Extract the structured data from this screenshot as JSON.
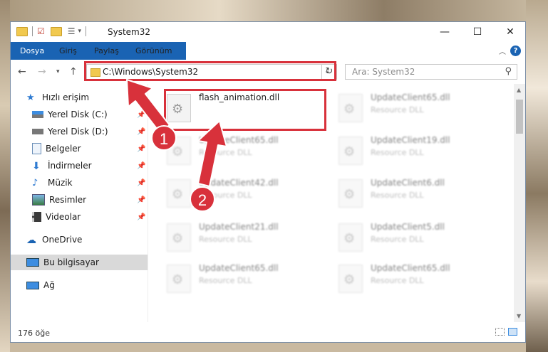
{
  "window": {
    "title": "System32",
    "minimize": "—",
    "maximize": "☐",
    "close": "✕"
  },
  "ribbon": {
    "tabs": [
      "Dosya",
      "Giriş",
      "Paylaş",
      "Görünüm"
    ],
    "help": "?"
  },
  "address": {
    "path": "C:\\Windows\\System32",
    "refresh": "↻"
  },
  "search": {
    "placeholder": "Ara: System32"
  },
  "sidebar": {
    "items": [
      {
        "label": "Hızlı erişim",
        "icon": "star-icon"
      },
      {
        "label": "Yerel Disk (C:)",
        "icon": "drive-icon"
      },
      {
        "label": "Yerel Disk (D:)",
        "icon": "drive-icon"
      },
      {
        "label": "Belgeler",
        "icon": "documents-icon"
      },
      {
        "label": "İndirmeler",
        "icon": "download-icon"
      },
      {
        "label": "Müzik",
        "icon": "music-icon"
      },
      {
        "label": "Resimler",
        "icon": "pictures-icon"
      },
      {
        "label": "Videolar",
        "icon": "videos-icon"
      },
      {
        "label": "OneDrive",
        "icon": "cloud-icon"
      },
      {
        "label": "Bu bilgisayar",
        "icon": "computer-icon"
      },
      {
        "label": "Ağ",
        "icon": "network-icon"
      }
    ]
  },
  "files": [
    {
      "name": "flash_animation.dll",
      "type": ""
    },
    {
      "name": "UpdateClient65.dll",
      "type": "Resource DLL"
    },
    {
      "name": "UpdateClient65.dll",
      "type": "Resource DLL"
    },
    {
      "name": "UpdateClient19.dll",
      "type": "Resource DLL"
    },
    {
      "name": "UpdateClient42.dll",
      "type": "Resource DLL"
    },
    {
      "name": "UpdateClient6.dll",
      "type": "Resource DLL"
    },
    {
      "name": "UpdateClient21.dll",
      "type": "Resource DLL"
    },
    {
      "name": "UpdateClient5.dll",
      "type": "Resource DLL"
    },
    {
      "name": "UpdateClient65.dll",
      "type": "Resource DLL"
    },
    {
      "name": "UpdateClient65.dll",
      "type": "Resource DLL"
    }
  ],
  "status": {
    "count": "176 öğe"
  },
  "annotations": {
    "step1": "1",
    "step2": "2",
    "color": "#d8313b"
  }
}
